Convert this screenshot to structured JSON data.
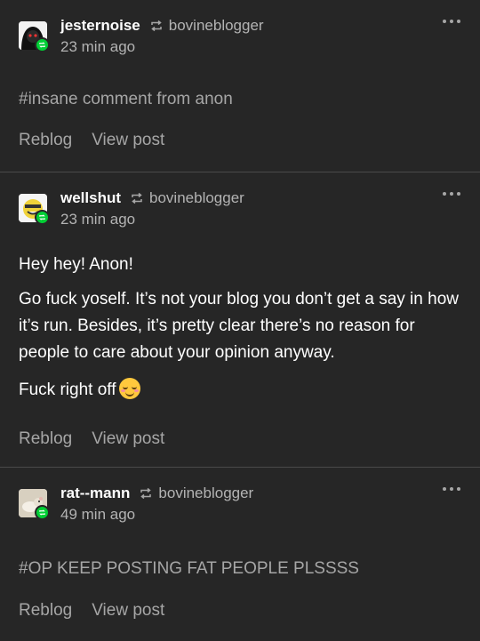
{
  "posts": [
    {
      "username": "jesternoise",
      "source": "bovineblogger",
      "time": "23 min ago",
      "tags": "#insane comment from anon",
      "paragraphs": [],
      "actions": {
        "reblog": "Reblog",
        "view": "View post"
      }
    },
    {
      "username": "wellshut",
      "source": "bovineblogger",
      "time": "23 min ago",
      "tags": "",
      "paragraphs": [
        "Hey hey! Anon!",
        "Go fuck yoself. It’s not your blog you don’t get a say in how it’s run. Besides, it’s pretty clear there’s no reason for people to care about your opinion anyway.",
        "Fuck right off"
      ],
      "emoji": "smiling-face-emoji",
      "actions": {
        "reblog": "Reblog",
        "view": "View post"
      }
    },
    {
      "username": "rat--mann",
      "source": "bovineblogger",
      "time": "49 min ago",
      "tags": "#OP KEEP POSTING FAT PEOPLE PLSSSS",
      "paragraphs": [],
      "actions": {
        "reblog": "Reblog",
        "view": "View post"
      }
    }
  ],
  "colors": {
    "background": "#262626",
    "text": "#ffffff",
    "muted": "#a6a6a6",
    "reblog_badge": "#00cf35",
    "divider": "#4a4a4a"
  }
}
